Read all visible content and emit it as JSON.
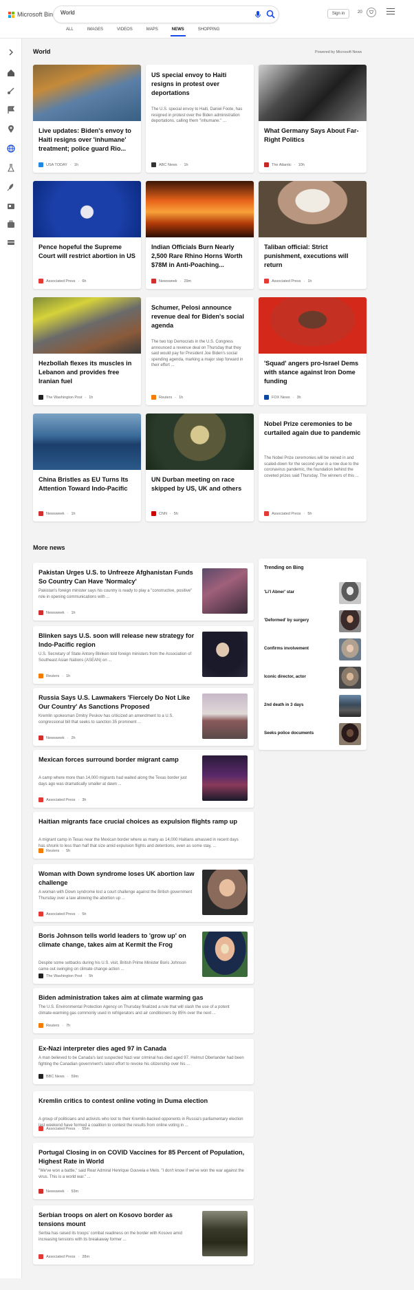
{
  "header": {
    "logo_text": "Microsoft Bing",
    "search_value": "World",
    "signin_label": "Sign in",
    "points": "20",
    "logo_colors": [
      "#f25022",
      "#7fba00",
      "#00a4ef",
      "#ffb900"
    ],
    "accent": "#174ae4"
  },
  "tabs": [
    {
      "label": "ALL",
      "active": false
    },
    {
      "label": "IMAGES",
      "active": false
    },
    {
      "label": "VIDEOS",
      "active": false
    },
    {
      "label": "MAPS",
      "active": false
    },
    {
      "label": "NEWS",
      "active": true
    },
    {
      "label": "SHOPPING",
      "active": false
    }
  ],
  "rail": [
    {
      "icon": "chevron-right-icon"
    },
    {
      "icon": "home-icon"
    },
    {
      "icon": "sports-icon"
    },
    {
      "icon": "flag-icon"
    },
    {
      "icon": "location-icon"
    },
    {
      "icon": "globe-icon"
    },
    {
      "icon": "science-icon"
    },
    {
      "icon": "rocket-icon"
    },
    {
      "icon": "entertainment-icon"
    },
    {
      "icon": "briefcase-icon"
    },
    {
      "icon": "money-icon"
    }
  ],
  "world": {
    "title": "World",
    "powered_by": "Powered by Microsoft News",
    "cards": [
      {
        "title": "Live updates: Biden's envoy to Haiti resigns over 'inhumane' treatment; police guard Rio...",
        "snippet": "",
        "source": "USA TODAY",
        "time": "1h",
        "source_color": "#1e88e5",
        "has_image": true,
        "image": "haiti-river"
      },
      {
        "title": "US special envoy to Haiti resigns in protest over deportations",
        "snippet": "The U.S. special envoy to Haiti, Daniel Foote, has resigned in protest over the Biden administration deportations, calling them \"inhumane.\" ...",
        "source": "ABC News",
        "time": "1h",
        "source_color": "#333333",
        "has_image": false
      },
      {
        "title": "What Germany Says About Far-Right Politics",
        "snippet": "",
        "source": "The Atlantic",
        "time": "10h",
        "source_color": "#c62828",
        "has_image": true,
        "image": "germany-bw"
      },
      {
        "title": "Pence hopeful the Supreme Court will restrict abortion in US",
        "snippet": "",
        "source": "Associated Press",
        "time": "6h",
        "source_color": "#e53935",
        "has_image": true,
        "image": "pence-stage"
      },
      {
        "title": "Indian Officials Burn Nearly 2,500 Rare Rhino Horns Worth $78M in Anti-Poaching...",
        "snippet": "",
        "source": "Newsweek",
        "time": "29m",
        "source_color": "#d32f2f",
        "has_image": true,
        "image": "rhino-fire"
      },
      {
        "title": "Taliban official: Strict punishment, executions will return",
        "snippet": "",
        "source": "Associated Press",
        "time": "1h",
        "source_color": "#e53935",
        "has_image": true,
        "image": "taliban-portrait"
      },
      {
        "title": "Hezbollah flexes its muscles in Lebanon and provides free Iranian fuel",
        "snippet": "",
        "source": "The Washington Post",
        "time": "1h",
        "source_color": "#222222",
        "has_image": true,
        "image": "hezbollah-trucks"
      },
      {
        "title": "Schumer, Pelosi announce revenue deal for Biden's social agenda",
        "snippet": "The two top Democrats in the U.S. Congress announced a revenue deal on Thursday that they said would pay for President Joe Biden's social spending agenda, marking a major step forward in their effort ...",
        "source": "Reuters",
        "time": "1h",
        "source_color": "#f57c00",
        "has_image": false
      },
      {
        "title": "'Squad' angers pro-Israel Dems with stance against Iron Dome funding",
        "snippet": "",
        "source": "FOX News",
        "time": "3h",
        "source_color": "#0d47a1",
        "has_image": true,
        "image": "squad-portrait"
      },
      {
        "title": "China Bristles as EU Turns Its Attention Toward Indo-Pacific",
        "snippet": "",
        "source": "Newsweek",
        "time": "1h",
        "source_color": "#d32f2f",
        "has_image": true,
        "image": "submarine"
      },
      {
        "title": "UN Durban meeting on race skipped by US, UK and others",
        "snippet": "",
        "source": "CNN",
        "time": "5h",
        "source_color": "#cc0000",
        "has_image": true,
        "image": "un-hall"
      },
      {
        "title": "Nobel Prize ceremonies to be curtailed again due to pandemic",
        "snippet": "The Nobel Prize ceremonies will be reined in and scaled-down for the second year in a row due to the coronavirus pandemic, the foundation behind the coveted prizes said Thursday. The winners of this ...",
        "source": "Associated Press",
        "time": "5h",
        "source_color": "#e53935",
        "has_image": false
      }
    ]
  },
  "more_news": {
    "title": "More news",
    "items": [
      {
        "title": "Pakistan Urges U.S. to Unfreeze Afghanistan Funds So Country Can Have 'Normalcy'",
        "snippet": "Pakistan's foreign minister says his country is ready to play a \"constructive, positive\" role in opening communications with ...",
        "source": "Newsweek",
        "time": "1h",
        "source_color": "#d32f2f",
        "thumb": "crowd-women"
      },
      {
        "title": "Blinken says U.S. soon will release new strategy for Indo-Pacific region",
        "snippet": "U.S. Secretary of State Antony Blinken told foreign ministers from the Association of Southeast Asian Nations (ASEAN) on ...",
        "source": "Reuters",
        "time": "1h",
        "source_color": "#f57c00",
        "thumb": "blinken"
      },
      {
        "title": "Russia Says U.S. Lawmakers 'Fiercely Do Not Like Our Country' As Sanctions Proposed",
        "snippet": "Kremlin spokesman Dmitry Peskov has criticized an amendment to a U.S. congressional bill that seeks to sanction 35 prominent ...",
        "source": "Newsweek",
        "time": "2h",
        "source_color": "#d32f2f",
        "thumb": "kremlin"
      },
      {
        "title": "Mexican forces surround border migrant camp",
        "snippet": "A camp where more than 14,000 migrants had waited along the Texas border just days ago was dramatically smaller at dawn ...",
        "source": "Associated Press",
        "time": "3h",
        "source_color": "#e53935",
        "thumb": "night-forces"
      },
      {
        "title": "Haitian migrants face crucial choices as expulsion flights ramp up",
        "snippet": "A migrant camp in Texas near the Mexican border where as many as 14,000 Haitians amassed in recent days has shrunk to less than half that size amid expulsion flights and detentions, even as some stay, ...",
        "source": "Reuters",
        "time": "5h",
        "source_color": "#f57c00",
        "thumb": ""
      },
      {
        "title": "Woman with Down syndrome loses UK abortion law challenge",
        "snippet": "A woman with Down syndrome lost a court challenge against the British government Thursday over a law allowing the abortion up ...",
        "source": "Associated Press",
        "time": "5h",
        "source_color": "#e53935",
        "thumb": "woman-glasses"
      },
      {
        "title": "Boris Johnson tells world leaders to 'grow up' on climate change, takes aim at Kermit the Frog",
        "snippet": "Despite some setbacks during his U.S. visit, British Prime Minister Boris Johnson came out swinging on climate change action ...",
        "source": "The Washington Post",
        "time": "5h",
        "source_color": "#222222",
        "thumb": "boris"
      },
      {
        "title": "Biden administration takes aim at climate warming gas",
        "snippet": "The U.S. Environmental Protection Agency on Thursday finalized a rule that will slash the use of a potent climate-warming gas commonly used in refrigerators and air conditioners by 85% over the next ...",
        "source": "Reuters",
        "time": "7h",
        "source_color": "#f57c00",
        "thumb": ""
      },
      {
        "title": "Ex-Nazi interpreter dies aged 97 in Canada",
        "snippet": "A man believed to be Canada's last suspected Nazi war criminal has died aged 97. Helmut Oberlander had been fighting the Canadian government's latest effort to revoke his citizenship over his ...",
        "source": "BBC News",
        "time": "59m",
        "source_color": "#222222",
        "thumb": ""
      },
      {
        "title": "Kremlin critics to contest online voting in Duma election",
        "snippet": "A group of politicians and activists who lost to their Kremlin-backed opponents in Russia's parliamentary election last weekend have formed a coalition to contest the results from online voting in ...",
        "source": "Associated Press",
        "time": "55m",
        "source_color": "#e53935",
        "thumb": ""
      },
      {
        "title": "Portugal Closing in on COVID Vaccines for 85 Percent of Population, Highest Rate in World",
        "snippet": "\"We've won a battle,\" said Rear Admiral Henrique Gouveia e Melo. \"I don't know if we've won the war against the virus. This is a world war.\" ...",
        "source": "Newsweek",
        "time": "53m",
        "source_color": "#d32f2f",
        "thumb": ""
      },
      {
        "title": "Serbian troops on alert on Kosovo border as tensions mount",
        "snippet": "Serbia has raised its troops' combat readiness on the border with Kosovo amid increasing tensions with its breakaway former ...",
        "source": "Associated Press",
        "time": "28m",
        "source_color": "#e53935",
        "thumb": "troops"
      }
    ]
  },
  "trending": {
    "title": "Trending on Bing",
    "items": [
      {
        "label": "'Li'l Abner' star",
        "image": "bw-portrait"
      },
      {
        "label": "'Deformed' by surgery",
        "image": "woman-dark"
      },
      {
        "label": "Confirms involvement",
        "image": "older-man"
      },
      {
        "label": "Iconic director, actor",
        "image": "director"
      },
      {
        "label": "2nd death in 3 days",
        "image": "street"
      },
      {
        "label": "Seeks police documents",
        "image": "man-dark"
      }
    ]
  }
}
